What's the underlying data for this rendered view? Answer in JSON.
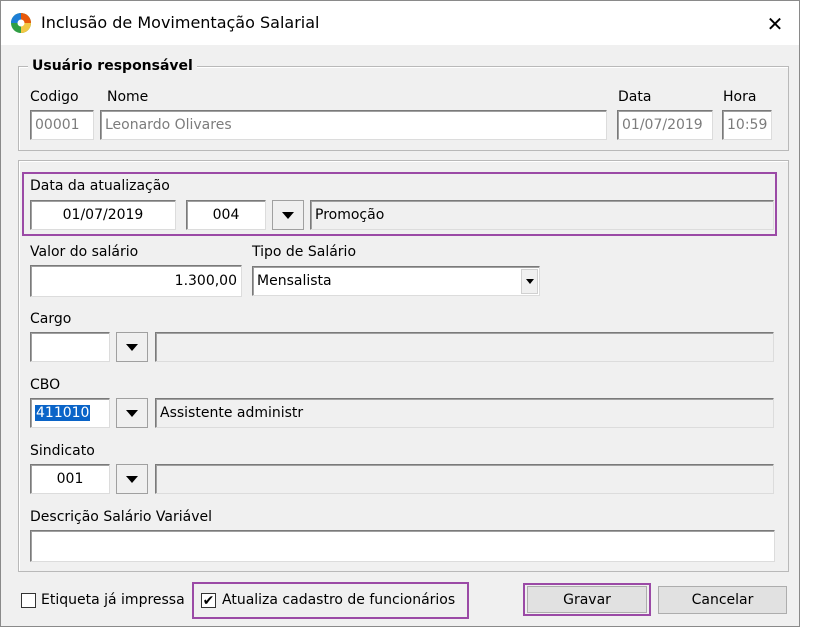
{
  "window": {
    "title": "Inclusão de Movimentação Salarial",
    "close_glyph": "✕"
  },
  "usuario": {
    "legend": "Usuário responsável",
    "codigo_label": "Codigo",
    "codigo_value": "00001",
    "nome_label": "Nome",
    "nome_value": "Leonardo Olivares",
    "data_label": "Data",
    "data_value": "01/07/2019",
    "hora_label": "Hora",
    "hora_value": "10:59"
  },
  "atualizacao": {
    "label": "Data da atualização",
    "date_value": "01/07/2019",
    "code_value": "004",
    "desc_value": "Promoção"
  },
  "salario": {
    "valor_label": "Valor do salário",
    "valor_value": "1.300,00",
    "tipo_label": "Tipo de Salário",
    "tipo_value": "Mensalista"
  },
  "cargo": {
    "label": "Cargo",
    "code_value": "",
    "desc_value": ""
  },
  "cbo": {
    "label": "CBO",
    "code_value": "411010",
    "desc_value": "Assistente administr"
  },
  "sindicato": {
    "label": "Sindicato",
    "code_value": "001",
    "desc_value": ""
  },
  "descricao": {
    "label": "Descrição Salário Variável",
    "value": ""
  },
  "footer": {
    "etiqueta_label": "Etiqueta já impressa",
    "etiqueta_checked": false,
    "atualiza_label": "Atualiza cadastro de funcionários",
    "atualiza_checked": true,
    "gravar_label": "Gravar",
    "cancelar_label": "Cancelar"
  },
  "colors": {
    "highlight": "#9b4aa6",
    "selection": "#0a64c8",
    "dialog_bg": "#f0f0f0"
  }
}
